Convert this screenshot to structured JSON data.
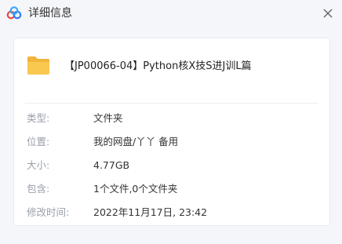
{
  "window": {
    "title": "详细信息",
    "logo_icon": "baidu-netdisk-logo",
    "close_icon": "close-icon"
  },
  "file": {
    "icon": "folder-icon",
    "name": "【JP00066-04】Python核X技S进J训L篇"
  },
  "details": [
    {
      "label": "类型:",
      "value": "文件夹"
    },
    {
      "label": "位置:",
      "value": "我的网盘/丫丫 备用"
    },
    {
      "label": "大小:",
      "value": "4.77GB"
    },
    {
      "label": "包含:",
      "value": "1个文件,0个文件夹"
    },
    {
      "label": "修改时间:",
      "value": "2022年11月17日, 23:42"
    }
  ],
  "colors": {
    "folder": "#f7c244",
    "label": "#9aa0ab",
    "background": "#f5f6fa"
  }
}
